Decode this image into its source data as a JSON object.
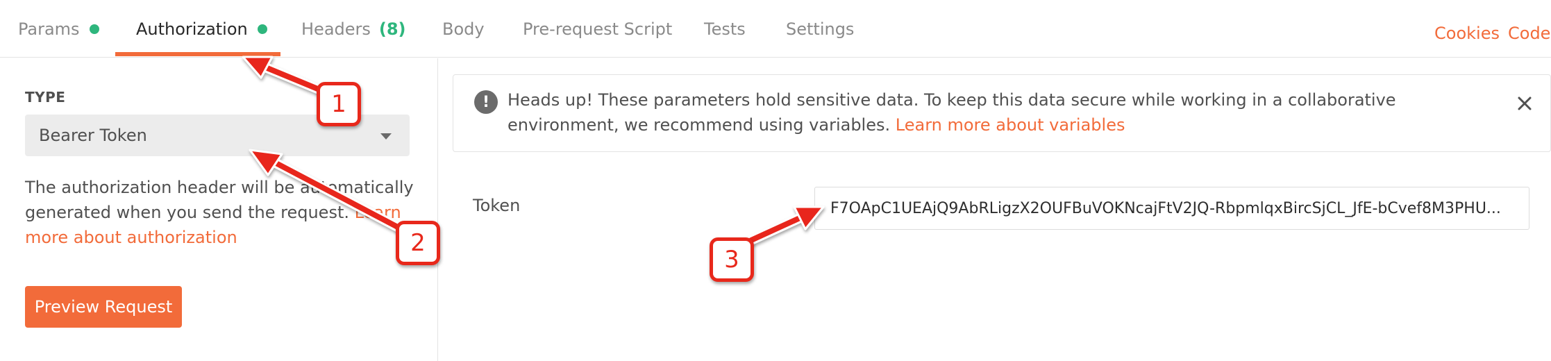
{
  "tabs": [
    {
      "label": "Params",
      "dot": true,
      "active": false
    },
    {
      "label": "Authorization",
      "dot": true,
      "active": true
    },
    {
      "label": "Headers",
      "count": "(8)",
      "active": false
    },
    {
      "label": "Body",
      "active": false
    },
    {
      "label": "Pre-request Script",
      "active": false
    },
    {
      "label": "Tests",
      "active": false
    },
    {
      "label": "Settings",
      "active": false
    }
  ],
  "top_links": {
    "cookies": "Cookies",
    "code": "Code"
  },
  "left": {
    "type_label": "TYPE",
    "type_value": "Bearer Token",
    "description": "The authorization header will be automatically generated when you send the request.",
    "description_link": "Learn more about authorization",
    "preview_button": "Preview Request"
  },
  "alert": {
    "text": "Heads up! These parameters hold sensitive data. To keep this data secure while working in a collaborative environment, we recommend using variables.",
    "link": "Learn more about variables",
    "icon": "exclamation-icon"
  },
  "token": {
    "label": "Token",
    "value": "F7OApC1UEAjQ9AbRLigzX2OUFBuVOKNcajFtV2JQ-RbpmlqxBircSjCL_JfE-bCvef8M3PHU..."
  },
  "annotations": [
    "1",
    "2",
    "3"
  ],
  "colors": {
    "accent": "#f26b3a",
    "status_dot": "#2eb67d",
    "annotation_red": "#e8281b"
  }
}
